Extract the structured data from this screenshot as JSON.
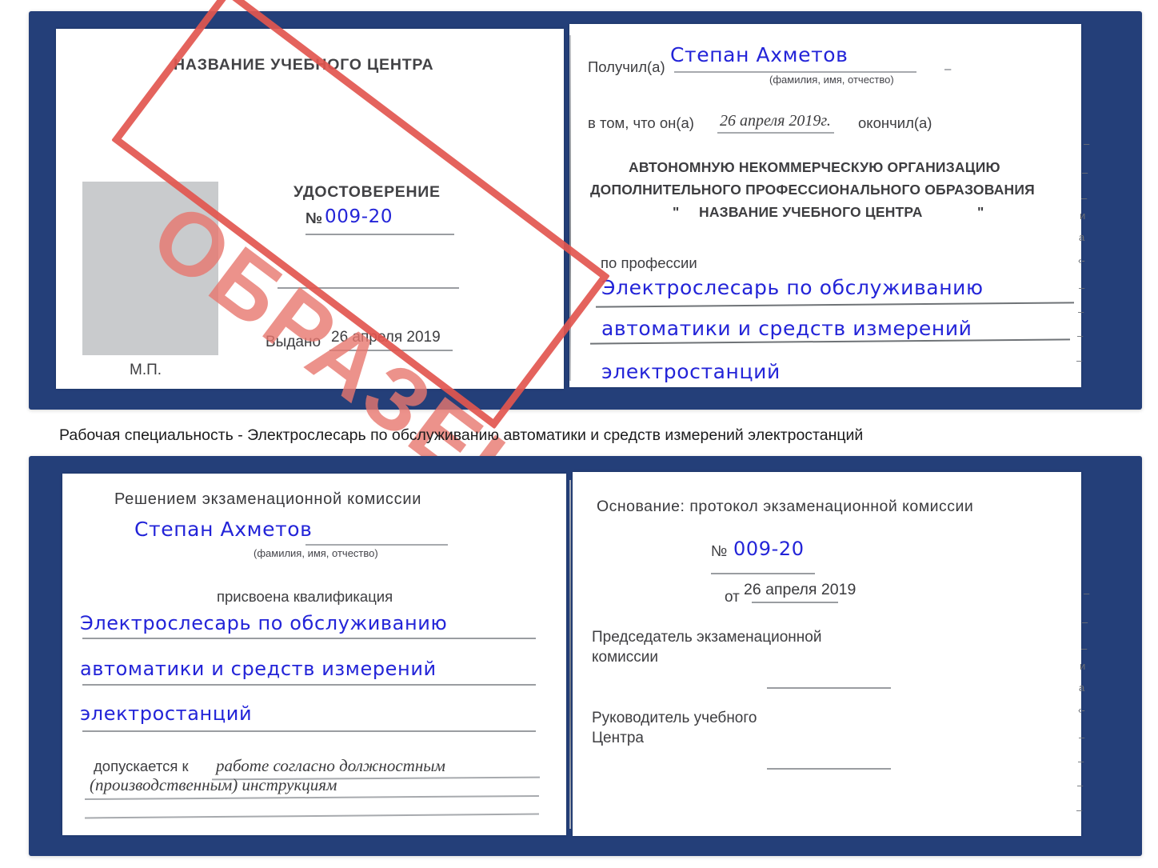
{
  "document": {
    "kind": "certificate-sample-scan",
    "stamp": {
      "label": "ОБРАЗЕЦ",
      "color": "#e2564f"
    },
    "ink_color": "#2324d8",
    "cover_color": "#243f79"
  },
  "caption": {
    "text": "Рабочая специальность - Электрослесарь по обслуживанию автоматики и средств измерений электростанций"
  },
  "certificate_top": {
    "left_page": {
      "title": "НАЗВАНИЕ УЧЕБНОГО ЦЕНТРА",
      "doc_type": "УДОСТОВЕРЕНИЕ",
      "number_label": "№",
      "number_value": "009-20",
      "issued_label": "Выдано",
      "issued_value": "26 апреля 2019",
      "seal_label": "М.П.",
      "photo_placeholder": "photo-area"
    },
    "right_page": {
      "received_label": "Получил(а)",
      "received_value": "Степан Ахметов",
      "name_hint": "(фамилия, имя, отчество)",
      "in_that_label": "в том, что он(а)",
      "completion_date": "26 апреля 2019г.",
      "finished_label": "окончил(а)",
      "organization_line1": "АВТОНОМНУЮ НЕКОММЕРЧЕСКУЮ ОРГАНИЗАЦИЮ",
      "organization_line2": "ДОПОЛНИТЕЛЬНОГО ПРОФЕССИОНАЛЬНОГО ОБРАЗОВАНИЯ",
      "organization_quote_open": "\"",
      "organization_line3": "НАЗВАНИЕ УЧЕБНОГО ЦЕНТРА",
      "organization_quote_close": "\"",
      "profession_label": "по профессии",
      "profession_line1": "Электрослесарь по обслуживанию",
      "profession_line2": "автоматики и средств измерений",
      "profession_line3": "электростанций",
      "edge_marks": [
        "–",
        "–",
        "–",
        "и",
        "а",
        "‹-",
        "–",
        "–",
        "–",
        "–"
      ]
    }
  },
  "certificate_bottom": {
    "left_page": {
      "decision_title": "Решением экзаменационной комиссии",
      "name_value": "Степан Ахметов",
      "name_hint": "(фамилия, имя, отчество)",
      "qualification_label": "присвоена квалификация",
      "qualification_line1": "Электрослесарь по обслуживанию",
      "qualification_line2": "автоматики и средств измерений",
      "qualification_line3": "электростанций",
      "admitted_label": "допускается к",
      "admitted_value_line1": "работе согласно должностным",
      "admitted_value_line2": "(производственным) инструкциям"
    },
    "right_page": {
      "basis_label": "Основание: протокол экзаменационной комиссии",
      "number_label": "№",
      "number_value": "009-20",
      "date_label": "от",
      "date_value": "26 апреля 2019",
      "chairman_line1": "Председатель экзаменационной",
      "chairman_line2": "комиссии",
      "head_line1": "Руководитель учебного",
      "head_line2": "Центра",
      "edge_marks": [
        "–",
        "–",
        "–",
        "и",
        "а",
        "‹-",
        "–",
        "–",
        "–",
        "–"
      ]
    }
  }
}
